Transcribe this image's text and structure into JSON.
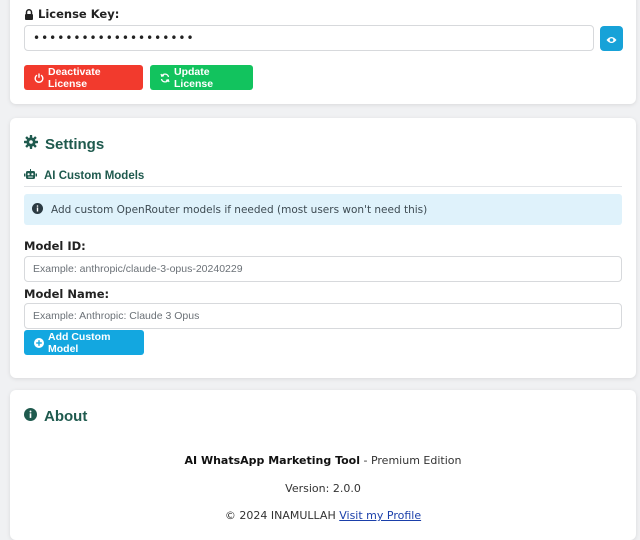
{
  "license": {
    "key_label": "License Key:",
    "key_value": "••••••••••••••••••••",
    "deactivate_label": "Deactivate License",
    "update_label": "Update License",
    "colors": {
      "deactivate": "#f23a2d",
      "update": "#12c35e",
      "toggle": "#17a2d8"
    }
  },
  "settings": {
    "title": "Settings",
    "custom_models": {
      "subtitle": "AI Custom Models",
      "info": "Add custom OpenRouter models if needed (most users won't need this)",
      "model_id_label": "Model ID:",
      "model_id_placeholder": "Example: anthropic/claude-3-opus-20240229",
      "model_name_label": "Model Name:",
      "model_name_placeholder": "Example: Anthropic: Claude 3 Opus",
      "add_button": "Add Custom Model"
    }
  },
  "about": {
    "title": "About",
    "product_name": "AI WhatsApp Marketing Tool",
    "edition": " - Premium Edition",
    "version": "Version: 2.0.0",
    "copyright": "© 2024 INAMULLAH ",
    "profile_link": "Visit my Profile"
  },
  "icons": {
    "lock": "lock-icon",
    "eye": "eye-icon",
    "power": "power-icon",
    "sync": "sync-icon",
    "gear": "gear-icon",
    "robot": "robot-icon",
    "info": "info-circle-icon",
    "plus": "plus-circle-icon"
  }
}
